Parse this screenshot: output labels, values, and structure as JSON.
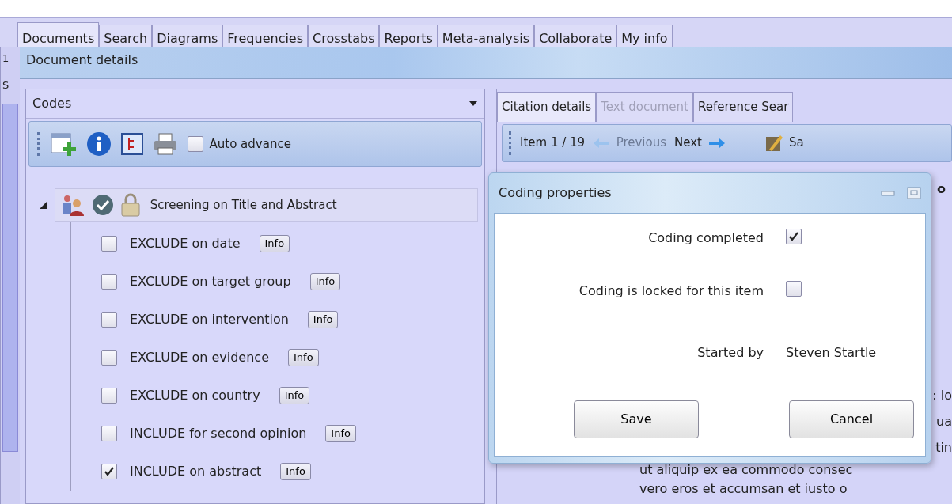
{
  "main_tabs": [
    {
      "label": "Documents",
      "selected": true
    },
    {
      "label": "Search",
      "selected": false
    },
    {
      "label": "Diagrams",
      "selected": false
    },
    {
      "label": "Frequencies",
      "selected": false
    },
    {
      "label": "Crosstabs",
      "selected": false
    },
    {
      "label": "Reports",
      "selected": false
    },
    {
      "label": "Meta-analysis",
      "selected": false
    },
    {
      "label": "Collaborate",
      "selected": false
    },
    {
      "label": "My info",
      "selected": false
    }
  ],
  "background_strip": {
    "labels": [
      "1",
      "S"
    ]
  },
  "window": {
    "title": "Document details"
  },
  "codes_panel": {
    "title": "Codes",
    "auto_advance": {
      "label": "Auto advance",
      "checked": false
    },
    "tree": [
      {
        "label": "Screening on Title and Abstract",
        "expanded": true,
        "children": [
          {
            "label": "EXCLUDE on date",
            "checked": false,
            "button": "Info"
          },
          {
            "label": "EXCLUDE on target group",
            "checked": false,
            "button": "Info"
          },
          {
            "label": "EXCLUDE on intervention",
            "checked": false,
            "button": "Info"
          },
          {
            "label": "EXCLUDE on evidence",
            "checked": false,
            "button": "Info"
          },
          {
            "label": "EXCLUDE on country",
            "checked": false,
            "button": "Info"
          },
          {
            "label": "INCLUDE for second opinion",
            "checked": false,
            "button": "Info"
          },
          {
            "label": "INCLUDE on abstract",
            "checked": true,
            "button": "Info"
          }
        ]
      }
    ]
  },
  "detail_panel": {
    "tabs": [
      {
        "label": "Citation details",
        "selected": true,
        "disabled": false
      },
      {
        "label": "Text document",
        "selected": false,
        "disabled": true
      },
      {
        "label": "Reference Sear",
        "selected": false,
        "disabled": false
      }
    ],
    "toolbar": {
      "item": "Item 1 / 19",
      "previous": {
        "label": "Previous",
        "disabled": true
      },
      "next": {
        "label": "Next",
        "disabled": false
      },
      "save": "Sa"
    },
    "heading_fragment": "o",
    "text_fragments": [
      ": lo",
      "ua",
      "tin"
    ],
    "text_lines": [
      "ut aliquip ex ea commodo consec",
      "vero eros et accumsan et iusto o"
    ]
  },
  "dialog": {
    "title": "Coding properties",
    "fields": [
      {
        "kind": "checkbox",
        "label": "Coding completed",
        "checked": true
      },
      {
        "kind": "checkbox",
        "label": "Coding is locked for this item",
        "checked": false
      },
      {
        "kind": "text",
        "label": "Started by",
        "value": "Steven Startle"
      }
    ],
    "buttons": [
      "Save",
      "Cancel"
    ]
  }
}
